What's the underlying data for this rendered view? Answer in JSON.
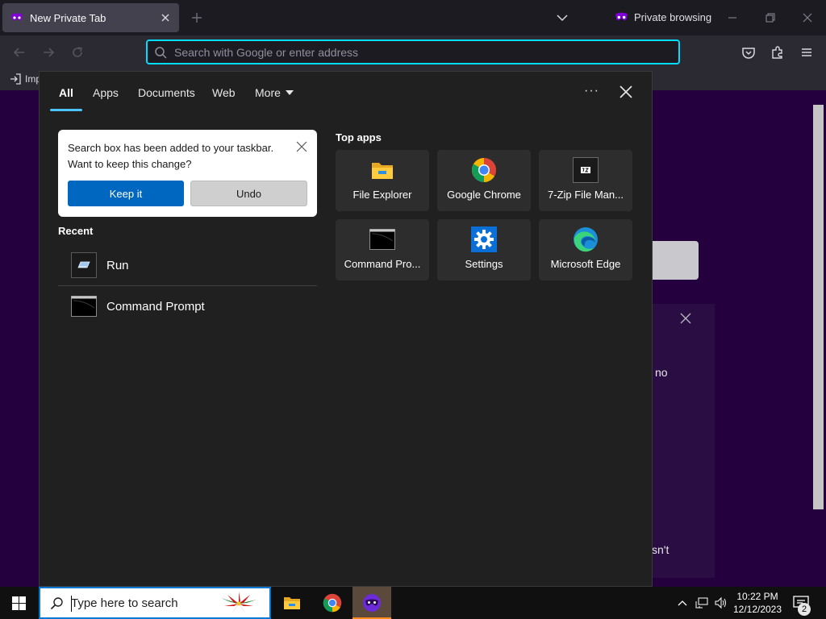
{
  "browser": {
    "tab_title": "New Private Tab",
    "private_label": "Private browsing",
    "url_placeholder": "Search with Google or enter address",
    "bookmark_import_label": "Imp",
    "content_fragment_no": "no",
    "content_fragment_isnt": "sn't"
  },
  "search_panel": {
    "tabs": [
      "All",
      "Apps",
      "Documents",
      "Web",
      "More"
    ],
    "active_tab": "All",
    "options_label": "···",
    "tip": {
      "text": "Search box has been added to your taskbar. Want to keep this change?",
      "keep_label": "Keep it",
      "undo_label": "Undo"
    },
    "recent_heading": "Recent",
    "recent": [
      {
        "label": "Run",
        "icon": "run-icon"
      },
      {
        "label": "Command Prompt",
        "icon": "command-prompt-icon"
      }
    ],
    "top_apps_heading": "Top apps",
    "top_apps": [
      {
        "label": "File Explorer",
        "icon": "file-explorer-icon"
      },
      {
        "label": "Google Chrome",
        "icon": "chrome-icon"
      },
      {
        "label": "7-Zip File Man...",
        "icon": "7zip-icon"
      },
      {
        "label": "Command Pro...",
        "icon": "command-prompt-icon"
      },
      {
        "label": "Settings",
        "icon": "settings-gear-icon"
      },
      {
        "label": "Microsoft Edge",
        "icon": "edge-icon"
      }
    ]
  },
  "taskbar": {
    "search_text": "Type here to search",
    "time": "10:22 PM",
    "date": "12/12/2023",
    "notification_count": "2"
  },
  "colors": {
    "accent": "#0067c0",
    "selected_tab": "#4cc2ff",
    "firefox_private": "#25003e",
    "url_focus": "#00ddff"
  }
}
